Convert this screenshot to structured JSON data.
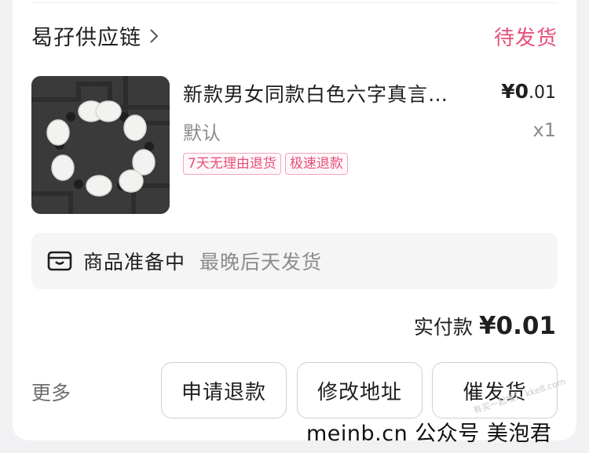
{
  "shop": {
    "name": "曷孖供应链",
    "status": "待发货"
  },
  "item": {
    "title": "新款男女同款白色六字真言…",
    "price_symbol": "¥0",
    "price_decimal": ".01",
    "spec": "默认",
    "quantity": "x1",
    "tags": [
      "7天无理由退货",
      "极速退款"
    ]
  },
  "shipping": {
    "title": "商品准备中",
    "note": "最晚后天发货"
  },
  "payment": {
    "label": "实付款",
    "amount": "¥0.01"
  },
  "actions": {
    "more_label": "更多",
    "refund_label": "申请退款",
    "address_label": "修改地址",
    "urge_label": "催发货"
  },
  "watermark": {
    "text": "meinb.cn  公众号 美泡君",
    "ghost": "有买一起哦！ kke8.com"
  },
  "colors": {
    "accent": "#e6507a",
    "background": "#f1f1f3"
  }
}
